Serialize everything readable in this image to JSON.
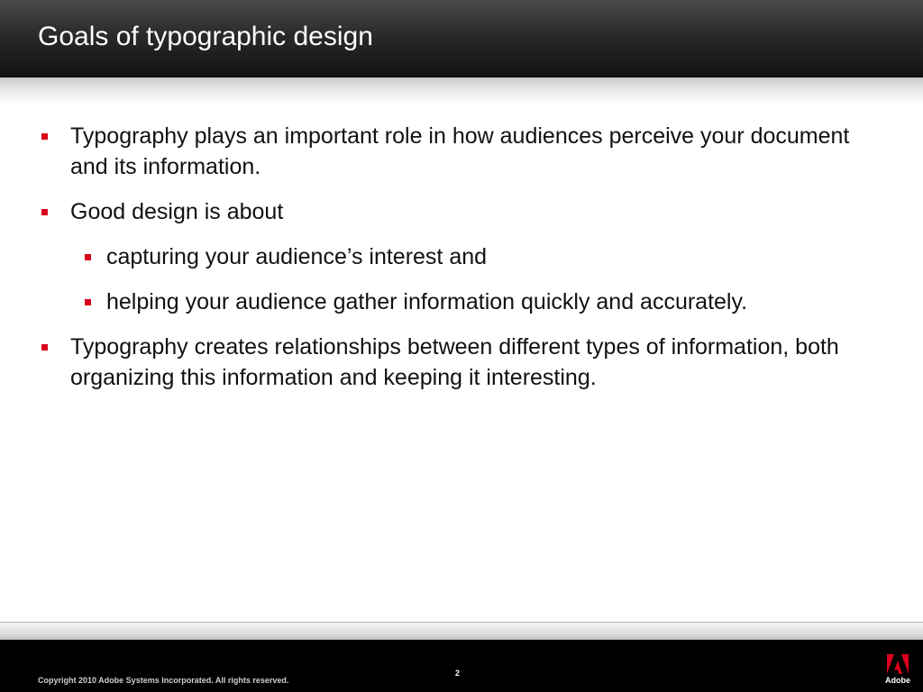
{
  "slide": {
    "title": "Goals of typographic design",
    "bullets": [
      {
        "level": 1,
        "text": "Typography plays an important role in how audiences perceive your document and its information."
      },
      {
        "level": 1,
        "text": "Good design is about"
      },
      {
        "level": 2,
        "text": "capturing your audience’s interest and"
      },
      {
        "level": 2,
        "text": "helping your audience gather information quickly and accurately."
      },
      {
        "level": 1,
        "text": "Typography creates relationships between different types of information, both organizing this information and keeping it interesting."
      }
    ],
    "bullet_color": "#d9001b"
  },
  "footer": {
    "copyright": "Copyright 2010 Adobe Systems Incorporated.  All rights reserved.",
    "page_number": "2",
    "logo_text": "Adobe",
    "logo_icon": "adobe-logo-icon",
    "logo_color": "#d9001b"
  }
}
